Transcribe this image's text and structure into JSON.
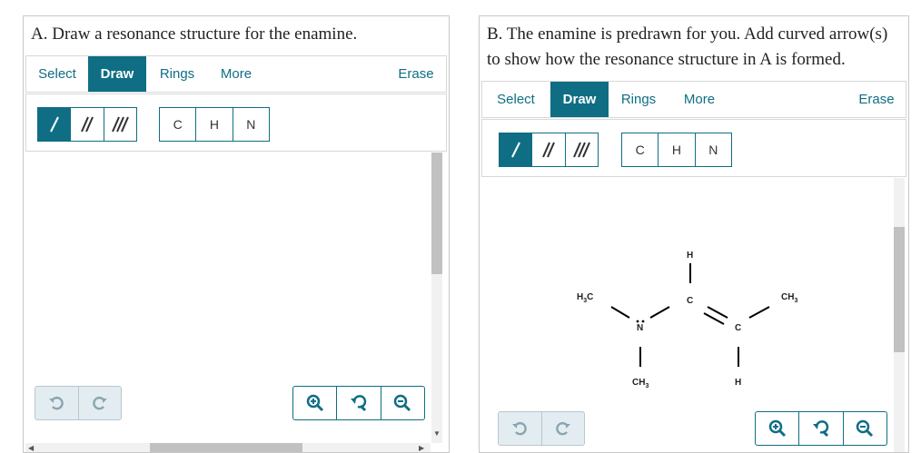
{
  "panel_a": {
    "prompt": "A. Draw a resonance structure for the enamine.",
    "tabs": {
      "select": "Select",
      "draw": "Draw",
      "rings": "Rings",
      "more": "More",
      "erase": "Erase"
    },
    "atoms": {
      "c": "C",
      "h": "H",
      "n": "N"
    }
  },
  "panel_b": {
    "prompt": "B. The enamine is predrawn for you. Add curved arrow(s) to show how the resonance structure in A is formed.",
    "tabs": {
      "select": "Select",
      "draw": "Draw",
      "rings": "Rings",
      "more": "More",
      "erase": "Erase"
    },
    "atoms": {
      "c": "C",
      "h": "H",
      "n": "N"
    },
    "molecule": {
      "h3c_left": "H",
      "h3c_sub": "3",
      "h3c_c": "C",
      "n": "N",
      "c_center": "C",
      "h_top": "H",
      "ch3_right": "CH",
      "ch3_right_sub": "3",
      "c_right": "C",
      "h_bottom": "H",
      "ch3_bottom": "CH",
      "ch3_bottom_sub": "3"
    }
  },
  "colors": {
    "accent": "#0f6e84",
    "border": "#c8c8c8",
    "scroll_thumb": "#c1c1c1"
  },
  "icons": {
    "single_bond": "single-bond-icon",
    "double_bond": "double-bond-icon",
    "triple_bond": "triple-bond-icon",
    "undo": "undo-icon",
    "redo": "redo-icon",
    "zoom_in": "zoom-in-icon",
    "zoom_reset": "zoom-reset-icon",
    "zoom_out": "zoom-out-icon"
  }
}
